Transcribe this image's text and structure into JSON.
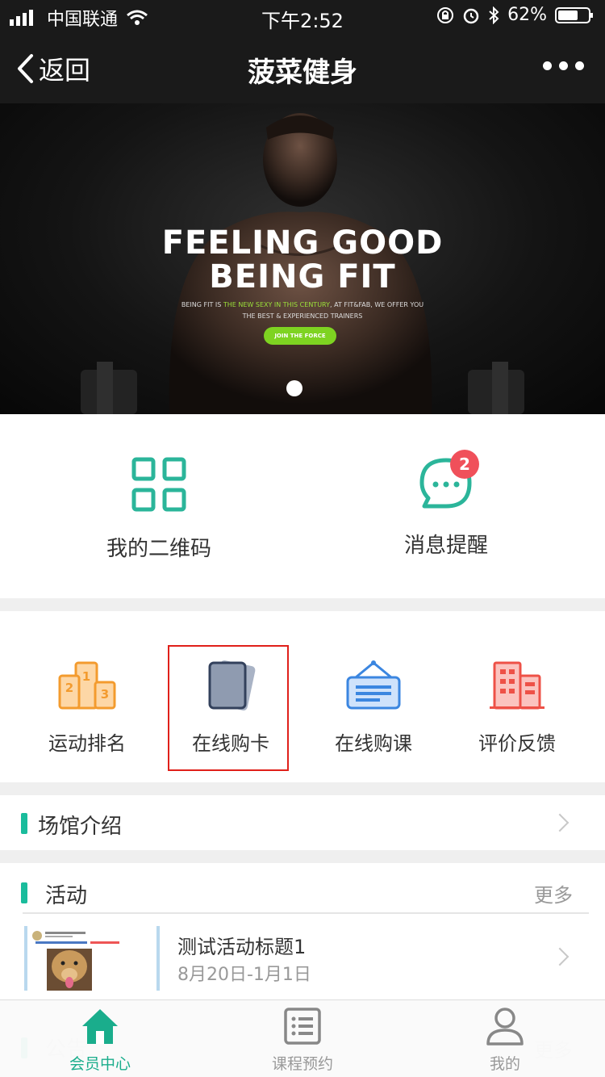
{
  "status_bar": {
    "carrier": "中国联通",
    "time": "下午2:52",
    "battery": "62%"
  },
  "nav": {
    "back_label": "返回",
    "title": "菠菜健身"
  },
  "banner": {
    "headline_line1": "FEELING GOOD",
    "headline_line2": "BEING FIT",
    "sub_prefix": "BEING FIT IS ",
    "sub_highlight": "THE NEW SEXY IN THIS CENTURY",
    "sub_suffix": ", AT FIT&FAB, WE OFFER YOU",
    "sub_line2": "THE BEST & EXPERIENCED TRAINERS",
    "cta": "JOIN THE FORCE",
    "slide_count": 1,
    "active_slide": 1
  },
  "quick_actions": [
    {
      "label": "我的二维码",
      "icon": "qr-code-icon"
    },
    {
      "label": "消息提醒",
      "icon": "message-bubble-icon",
      "badge": "2"
    }
  ],
  "menu": [
    {
      "label": "运动排名",
      "icon": "podium-icon"
    },
    {
      "label": "在线购卡",
      "icon": "cards-icon",
      "highlighted": true
    },
    {
      "label": "在线购课",
      "icon": "hanging-sign-icon"
    },
    {
      "label": "评价反馈",
      "icon": "building-icon"
    }
  ],
  "venue": {
    "title": "场馆介绍"
  },
  "activity": {
    "title": "活动",
    "more": "更多",
    "items": [
      {
        "title": "测试活动标题1",
        "date_range": "8月20日-1月1日"
      }
    ]
  },
  "hidden_section_fragment": {
    "title": "公告",
    "more": "更多"
  },
  "tabbar": [
    {
      "label": "会员中心",
      "icon": "home-icon",
      "active": true
    },
    {
      "label": "课程预约",
      "icon": "list-icon",
      "active": false
    },
    {
      "label": "我的",
      "icon": "user-icon",
      "active": false
    }
  ],
  "colors": {
    "accent": "#1aad8c",
    "teal_icon": "#2bb59a",
    "badge": "#f0505a",
    "highlight_border": "#e0201a",
    "nav_bg": "#1a1a1a"
  }
}
